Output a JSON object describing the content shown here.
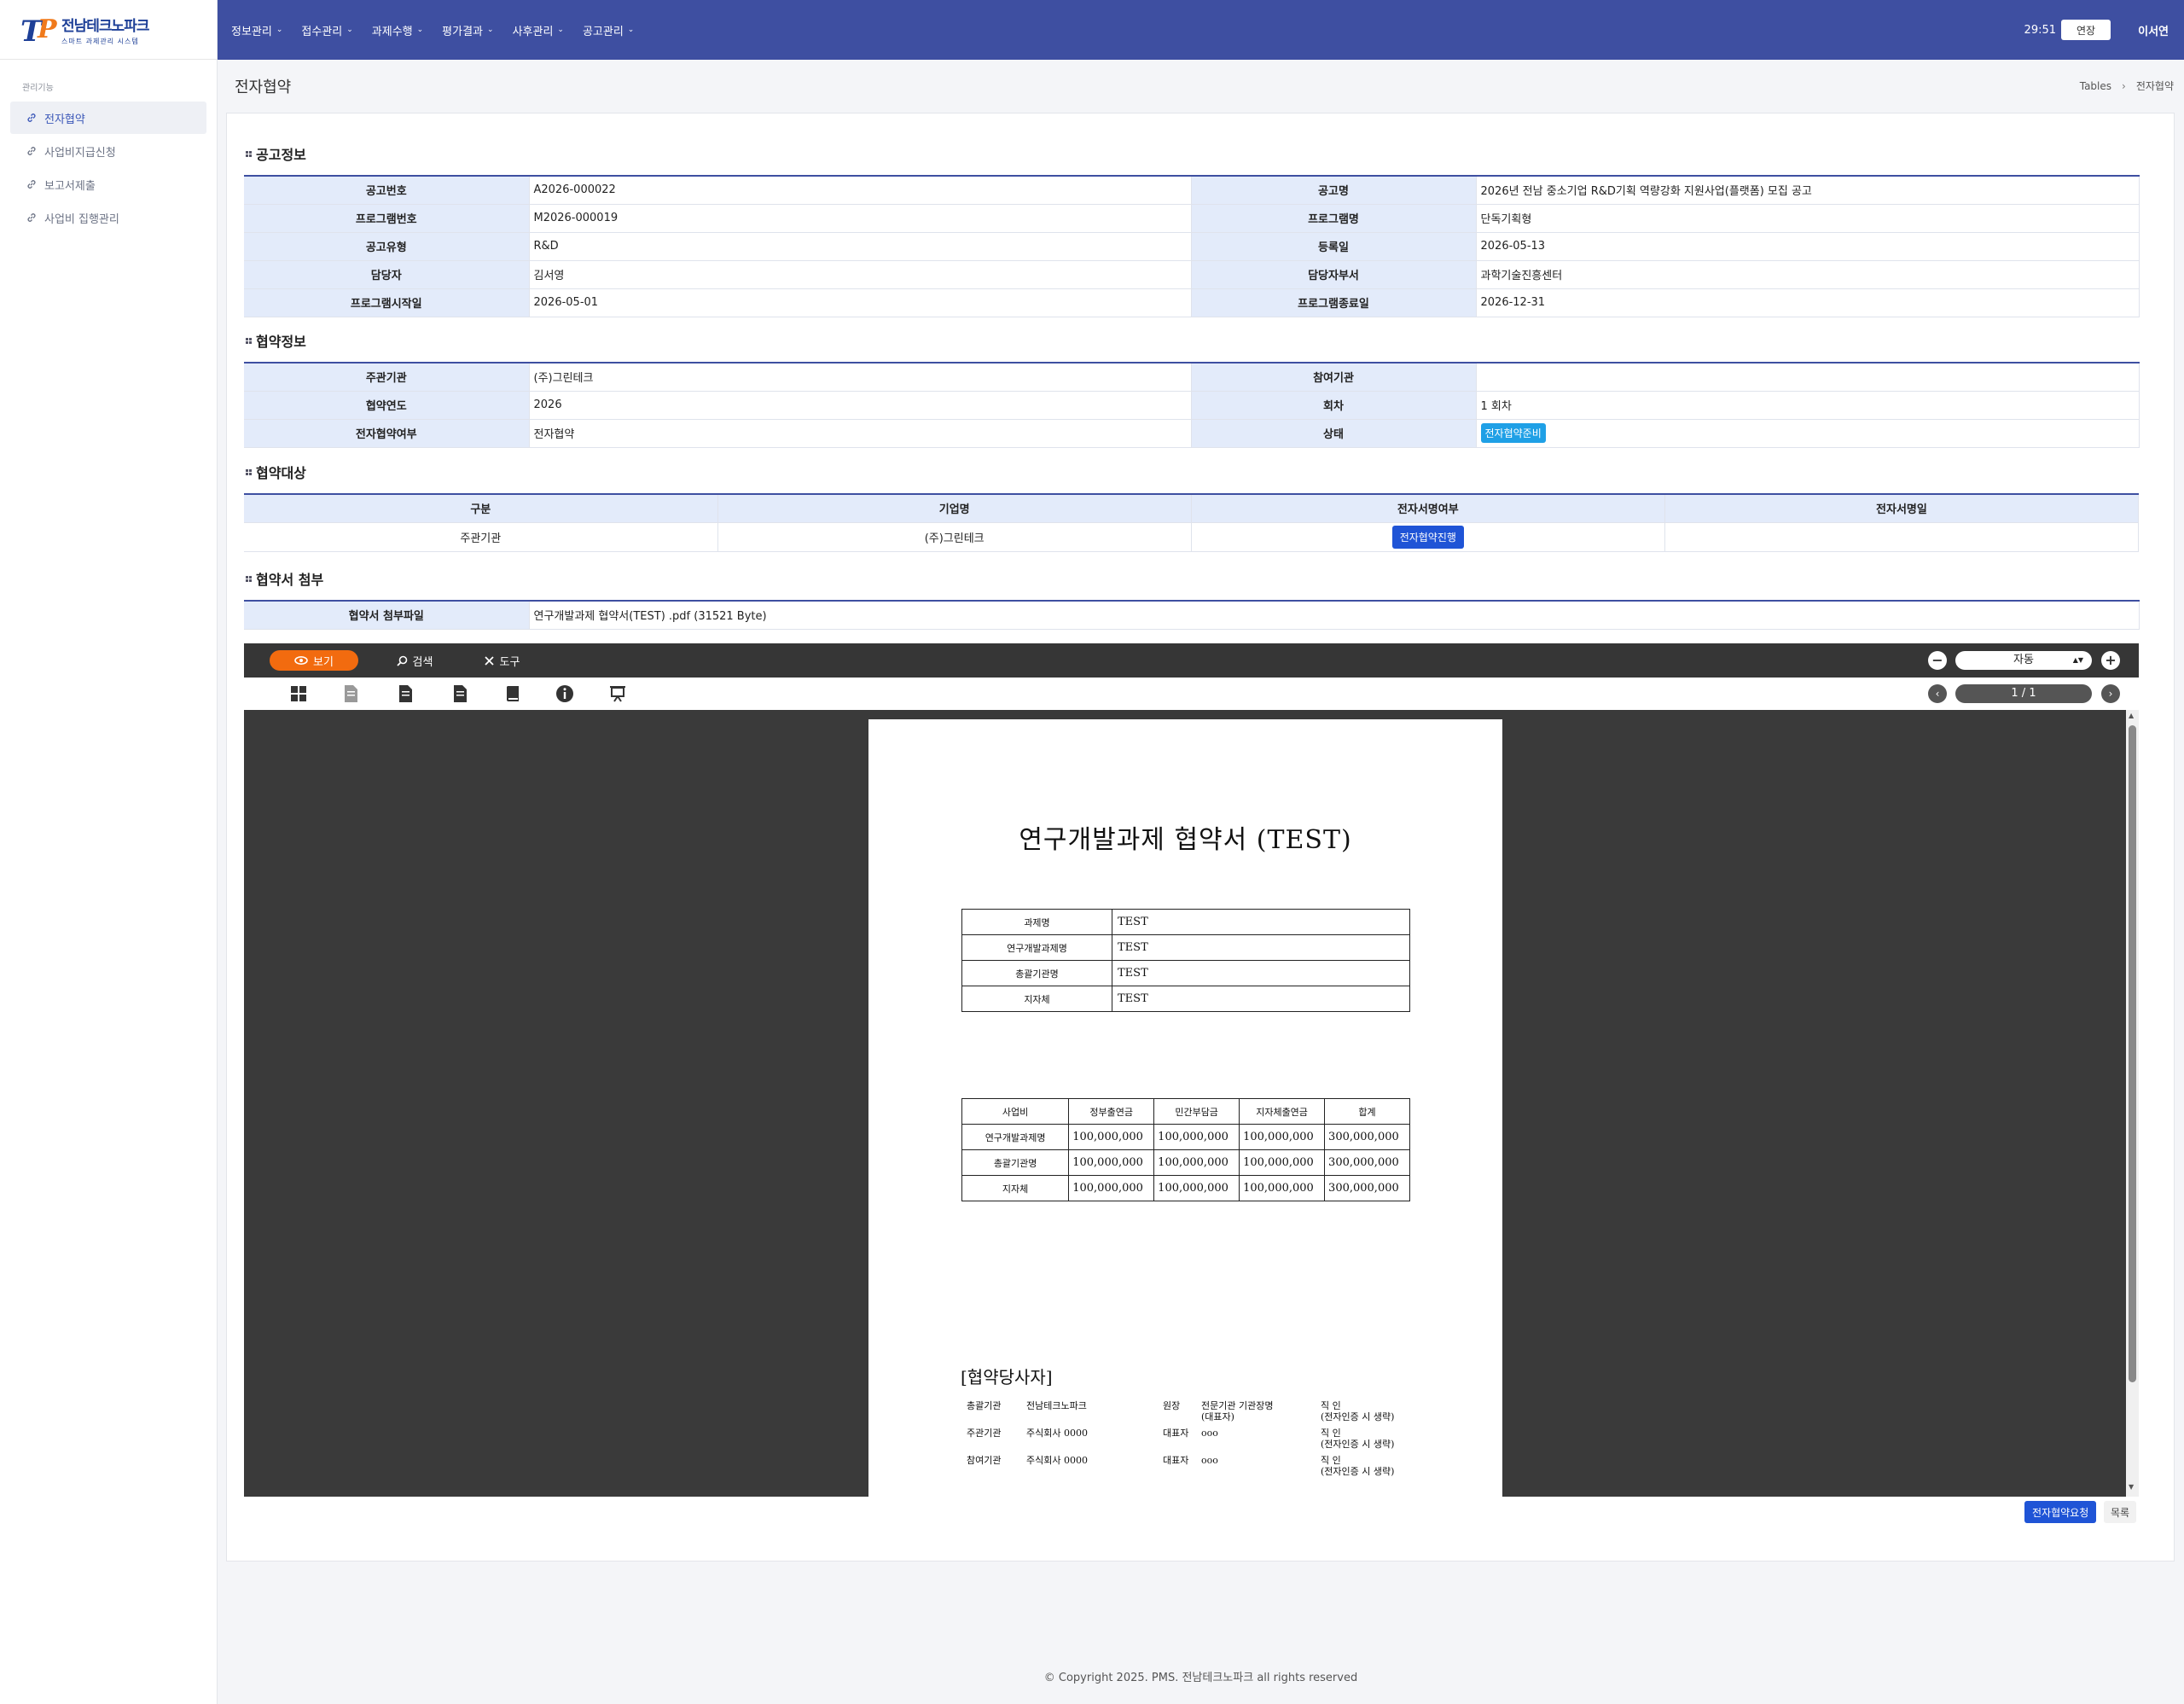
{
  "sidebar": {
    "logo_name": "전남테크노파크",
    "logo_sub": "스마트 과제관리 시스템",
    "logo_mark_letters": [
      "T",
      "P"
    ],
    "section_label": "관리기능",
    "items": [
      {
        "label": "전자협약",
        "active": true
      },
      {
        "label": "사업비지급신청",
        "active": false
      },
      {
        "label": "보고서제출",
        "active": false
      },
      {
        "label": "사업비 집행관리",
        "active": false
      }
    ]
  },
  "topbar": {
    "menu": [
      "정보관리",
      "접수관리",
      "과제수행",
      "평가결과",
      "사후관리",
      "공고관리"
    ],
    "timer": "29:51",
    "extend_label": "연장",
    "user_name": "이서연",
    "bg_color": "#3e4fa1"
  },
  "page": {
    "title": "전자협약",
    "breadcrumb": [
      "Tables",
      "전자협약"
    ]
  },
  "notice_info": {
    "section_title": "공고정보",
    "rows": [
      {
        "l1": "공고번호",
        "v1": "A2026-000022",
        "l2": "공고명",
        "v2": "2026년 전남 중소기업 R&D기획 역량강화 지원사업(플랫폼) 모집 공고"
      },
      {
        "l1": "프로그램번호",
        "v1": "M2026-000019",
        "l2": "프로그램명",
        "v2": "단독기획형"
      },
      {
        "l1": "공고유형",
        "v1": "R&D",
        "l2": "등록일",
        "v2": "2026-05-13"
      },
      {
        "l1": "담당자",
        "v1": "김서영",
        "l2": "담당자부서",
        "v2": "과학기술진흥센터"
      },
      {
        "l1": "프로그램시작일",
        "v1": "2026-05-01",
        "l2": "프로그램종료일",
        "v2": "2026-12-31"
      }
    ]
  },
  "agreement_info": {
    "section_title": "협약정보",
    "rows": [
      {
        "l1": "주관기관",
        "v1": "(주)그린테크",
        "l2": "참여기관",
        "v2": ""
      },
      {
        "l1": "협약연도",
        "v1": "2026",
        "l2": "회차",
        "v2": "1 회차"
      },
      {
        "l1": "전자협약여부",
        "v1": "전자협약",
        "l2": "상태",
        "v2": ""
      }
    ],
    "status_badge": "전자협약준비"
  },
  "agreement_target": {
    "section_title": "협약대상",
    "headers": [
      "구분",
      "기업명",
      "전자서명여부",
      "전자서명일"
    ],
    "row": {
      "type": "주관기관",
      "company": "(주)그린테크",
      "sign_button": "전자협약진행",
      "sign_date": ""
    }
  },
  "attachment": {
    "section_title": "협약서 첨부",
    "label": "협약서 첨부파일",
    "file": "연구개발과제 협약서(TEST) .pdf (31521 Byte)"
  },
  "viewer": {
    "tabs": [
      "보기",
      "검색",
      "도구"
    ],
    "zoom": "자동",
    "page_indicator": "1 / 1",
    "tools": [
      "thumbnail-grid-icon",
      "single-page-icon",
      "two-page-icon",
      "three-page-icon",
      "book-icon",
      "info-icon",
      "presentation-icon"
    ],
    "accent_color": "#f26b0f"
  },
  "pdf": {
    "title": "연구개발과제 협약서 (TEST)",
    "table1": [
      {
        "k": "과제명",
        "v": "TEST"
      },
      {
        "k": "연구개발과제명",
        "v": "TEST"
      },
      {
        "k": "총괄기관명",
        "v": "TEST"
      },
      {
        "k": "지자체",
        "v": "TEST"
      }
    ],
    "table2_headers": [
      "사업비",
      "정부출연금",
      "민간부담금",
      "지자체출연금",
      "합계"
    ],
    "table2_rows": [
      [
        "연구개발과제명",
        "100,000,000",
        "100,000,000",
        "100,000,000",
        "300,000,000"
      ],
      [
        "총괄기관명",
        "100,000,000",
        "100,000,000",
        "100,000,000",
        "300,000,000"
      ],
      [
        "지자체",
        "100,000,000",
        "100,000,000",
        "100,000,000",
        "300,000,000"
      ]
    ],
    "party_title": "[협약당사자]",
    "parties": [
      {
        "c1": "총괄기관",
        "c2": "전남테크노파크",
        "c3": "원장",
        "c4": "전문기관 기관장명\n(대표자)",
        "c5": "직 인\n(전자인증 시 생략)"
      },
      {
        "c1": "주관기관",
        "c2": "주식회사 0000",
        "c3": "대표자",
        "c4": "ooo",
        "c5": "직 인\n(전자인증 시 생략)"
      },
      {
        "c1": "참여기관",
        "c2": "주식회사 0000",
        "c3": "대표자",
        "c4": "ooo",
        "c5": "직 인\n(전자인증 시 생략)"
      }
    ]
  },
  "actions": {
    "request_label": "전자협약요청",
    "list_label": "목록"
  },
  "footer": "© Copyright 2025. PMS. 전남테크노파크 all rights reserved"
}
